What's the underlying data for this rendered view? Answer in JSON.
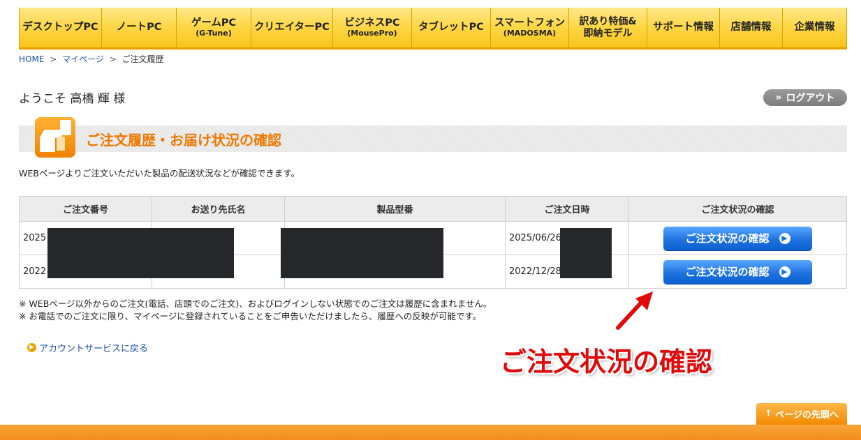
{
  "nav": {
    "items": [
      {
        "label": "デスクトップPC",
        "sub": ""
      },
      {
        "label": "ノートPC",
        "sub": ""
      },
      {
        "label": "ゲームPC",
        "sub": "(G-Tune)"
      },
      {
        "label": "クリエイターPC",
        "sub": ""
      },
      {
        "label": "ビジネスPC",
        "sub": "(MousePro)"
      },
      {
        "label": "タブレットPC",
        "sub": ""
      },
      {
        "label": "スマートフォン",
        "sub": "(MADOSMA)"
      },
      {
        "label": "訳あり特価&",
        "sub": "即納モデル"
      },
      {
        "label": "サポート情報",
        "sub": ""
      },
      {
        "label": "店舗情報",
        "sub": ""
      },
      {
        "label": "企業情報",
        "sub": ""
      }
    ]
  },
  "breadcrumb": {
    "home": "HOME",
    "mypage": "マイページ",
    "current": "ご注文履歴",
    "separator": ">"
  },
  "welcome": "ようこそ 高橋 輝 様",
  "logout": {
    "icon": "double-chevron-right-icon",
    "label": "ログアウト"
  },
  "section": {
    "title": "ご注文履歴・お届け状況の確認",
    "icon": "package-box-icon",
    "intro": "WEBページよりご注文いただいた製品の配送状況などが確認できます。"
  },
  "table": {
    "headers": [
      "ご注文番号",
      "お送り先氏名",
      "製品型番",
      "ご注文日時",
      "ご注文状況の確認"
    ],
    "rows": [
      {
        "order_no": "2025",
        "date": "2025/06/26",
        "button": "ご注文状況の確認"
      },
      {
        "order_no": "2022",
        "date": "2022/12/28",
        "button": "ご注文状況の確認"
      }
    ]
  },
  "notes": [
    "※ WEBページ以外からのご注文(電話、店頭でのご注文)、およびログインしない状態でのご注文は履歴に含まれません。",
    "※ お電話でのご注文に限り、マイページに登録されていることをご申告いただけましたら、履歴への反映が可能です。"
  ],
  "back_link": "アカウントサービスに戻る",
  "annotation": {
    "text": "ご注文状況の確認",
    "color": "#e00a0a"
  },
  "page_top": "ページの先頭へ",
  "colors": {
    "accent": "#f07800",
    "nav": "#ffd84a",
    "button": "#1f73e0"
  }
}
